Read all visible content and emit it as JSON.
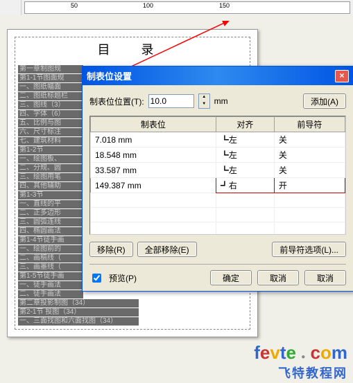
{
  "ruler": {
    "ticks": [
      "50",
      "100",
      "150"
    ]
  },
  "doc": {
    "title": "目 录",
    "lines": [
      "第一章制图规",
      "第1-1节图面规",
      "一、图纸幅面",
      "二、图纸标题栏",
      "三、图线（3）",
      "四、字体（6）",
      "五、比例与图",
      "六、尺寸标注",
      "七、建筑材料",
      "第1-2节",
      "一、绘图板、",
      "二、分规、圆",
      "三、绘图用笔",
      "四、其他辅助",
      "第1-3节",
      "一、直线的平",
      "二、正多边形",
      "三、圆弧连线",
      "四、椭圆画法",
      "第1-4节徒手画",
      "一、绘图前的",
      "二、画稿线（",
      "三、画墨线（",
      "第1-5节徒手画",
      "一、徒手画法",
      "二、徒手画法",
      "第二章投影制图（34）",
      "第2-1节                     投图（34）",
      "一、三面找图和六面找图（34）"
    ]
  },
  "dialog": {
    "title": "制表位设置",
    "pos_label": "制表位位置(T):",
    "pos_value": "10.0",
    "unit": "mm",
    "add_btn": "添加(A)",
    "cols": {
      "c1": "制表位",
      "c2": "对齐",
      "c3": "前导符"
    },
    "rows": [
      {
        "pos": "7.018 mm",
        "align": "┗左",
        "leader": "关"
      },
      {
        "pos": "18.548 mm",
        "align": "┗左",
        "leader": "关"
      },
      {
        "pos": "33.587 mm",
        "align": "┗左",
        "leader": "关"
      },
      {
        "pos": "149.387 mm",
        "align": "┛右",
        "leader": "开"
      }
    ],
    "remove_btn": "移除(R)",
    "remove_all_btn": "全部移除(E)",
    "leader_opts_btn": "前导符选项(L)...",
    "preview_label": "预览(P)",
    "ok_btn": "确定",
    "cancel_btn": "取消",
    "cancel_btn2": "取消"
  },
  "watermark": {
    "site": "fevte",
    "dot": "●",
    "com": "com",
    "cn": "飞特教程网"
  }
}
